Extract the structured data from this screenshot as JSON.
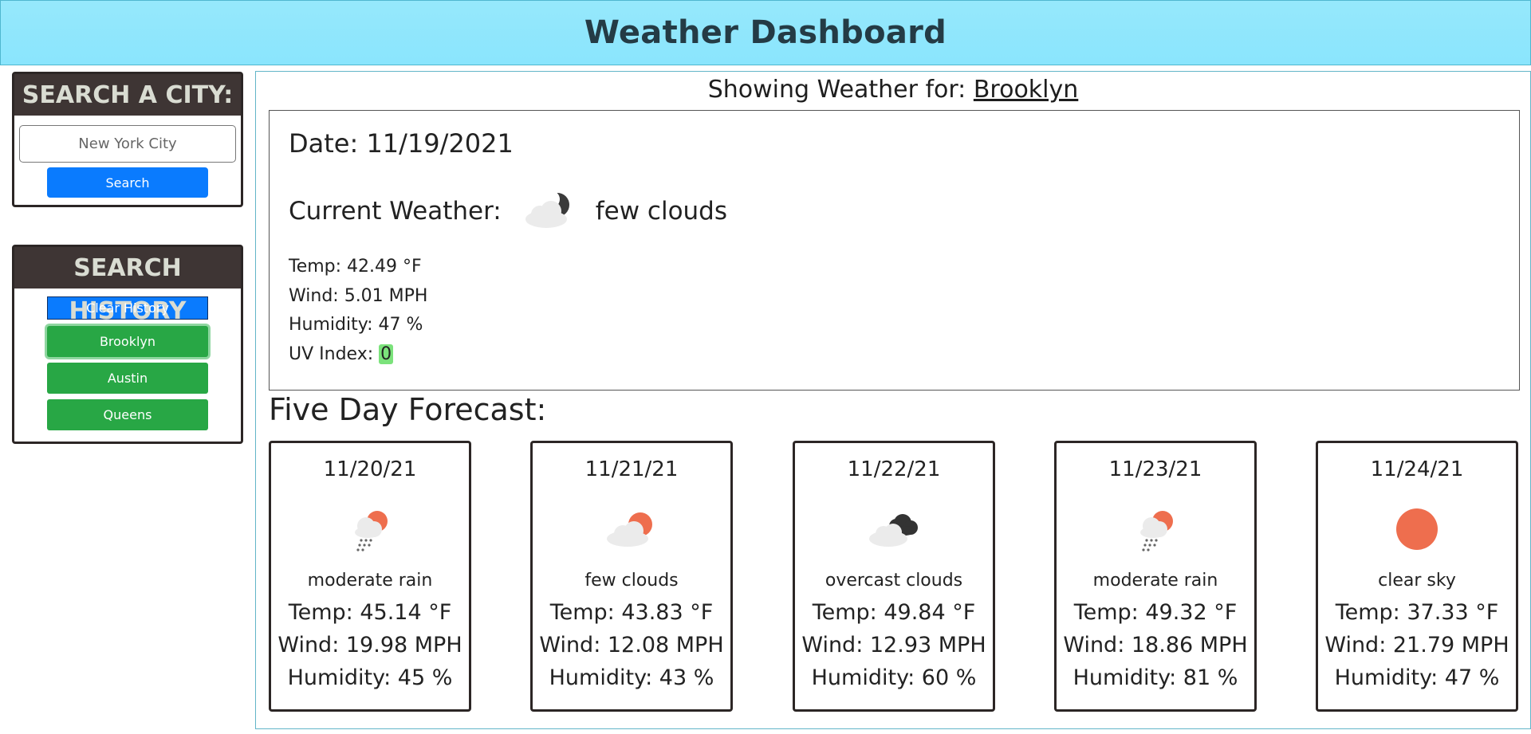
{
  "header": {
    "title": "Weather Dashboard"
  },
  "search": {
    "title": "SEARCH A CITY:",
    "placeholder": "New York City",
    "button_label": "Search"
  },
  "history": {
    "title": "SEARCH HISTORY",
    "clear_label": "Clear History",
    "items": [
      {
        "label": "Brooklyn"
      },
      {
        "label": "Austin"
      },
      {
        "label": "Queens"
      }
    ]
  },
  "current": {
    "showing_label": "Showing Weather for:",
    "city": "Brooklyn",
    "date_label": "Date: 11/19/2021",
    "current_label": "Current Weather:",
    "icon": "few-clouds-night-icon",
    "description": "few clouds",
    "temp": "Temp: 42.49 °F",
    "wind": "Wind: 5.01 MPH",
    "humidity": "Humidity: 47 %",
    "uv_label": "UV Index:",
    "uv_value": "0",
    "uv_color": "#7be27b"
  },
  "forecast": {
    "title": "Five Day Forecast:",
    "days": [
      {
        "date": "11/20/21",
        "icon": "rain-icon",
        "description": "moderate rain",
        "temp": "Temp: 45.14 °F",
        "wind": "Wind: 19.98 MPH",
        "humidity": "Humidity: 45 %"
      },
      {
        "date": "11/21/21",
        "icon": "few-clouds-icon",
        "description": "few clouds",
        "temp": "Temp: 43.83 °F",
        "wind": "Wind: 12.08 MPH",
        "humidity": "Humidity: 43 %"
      },
      {
        "date": "11/22/21",
        "icon": "overcast-clouds-icon",
        "description": "overcast clouds",
        "temp": "Temp: 49.84 °F",
        "wind": "Wind: 12.93 MPH",
        "humidity": "Humidity: 60 %"
      },
      {
        "date": "11/23/21",
        "icon": "rain-icon",
        "description": "moderate rain",
        "temp": "Temp: 49.32 °F",
        "wind": "Wind: 18.86 MPH",
        "humidity": "Humidity: 81 %"
      },
      {
        "date": "11/24/21",
        "icon": "clear-sky-icon",
        "description": "clear sky",
        "temp": "Temp: 37.33 °F",
        "wind": "Wind: 21.79 MPH",
        "humidity": "Humidity: 47 %"
      }
    ]
  },
  "colors": {
    "header_bg": "#8ae5fd",
    "panel_header_bg": "#3e3534",
    "primary_button": "#0a7bfe",
    "history_button": "#28a745",
    "sun": "#ee6e4e"
  }
}
